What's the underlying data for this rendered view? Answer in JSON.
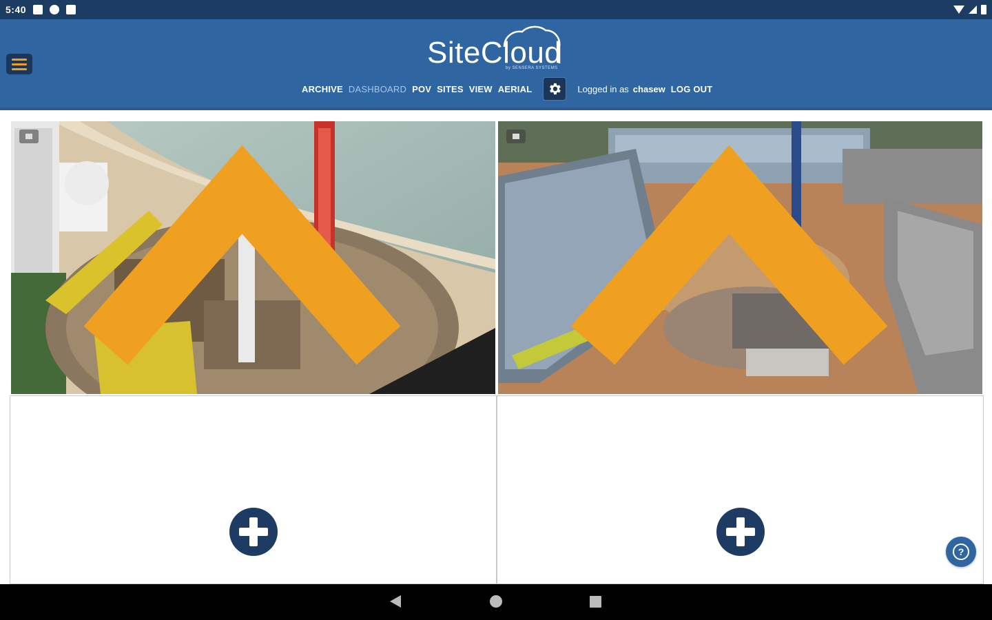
{
  "status_bar": {
    "time": "5:40",
    "icons": [
      "notification-icon",
      "app-icon",
      "sd-card-icon"
    ],
    "right_icons": [
      "wifi-icon",
      "signal-icon",
      "battery-icon"
    ]
  },
  "header": {
    "logo_text": "SiteCloud",
    "logo_sub": "by SENSERA SYSTEMS",
    "nav_links": [
      "ARCHIVE",
      "DASHBOARD",
      "POV",
      "SITES",
      "VIEW",
      "AERIAL"
    ],
    "active_link": "DASHBOARD",
    "logged_in_prefix": "Logged in as",
    "username": "chasew",
    "logout_label": "LOG OUT"
  },
  "colors": {
    "header_bg": "#2f65a0",
    "status_bg": "#1d3c63",
    "button_dark": "#1b3658",
    "menu_accent": "#f0a021",
    "active_link": "#a7c7ef",
    "add_button": "#1d3b63"
  },
  "camera_tiles": [
    {
      "scene": "beachfront-tower-construction",
      "expand_icon": "chevron-up-icon"
    },
    {
      "scene": "building-site-aerial",
      "expand_icon": "chevron-up-icon"
    }
  ],
  "empty_tiles": [
    {
      "icon": "plus-icon"
    },
    {
      "icon": "plus-icon"
    }
  ],
  "help_icon": "help-icon",
  "help_glyph": "?",
  "nav_bar": [
    "back-icon",
    "home-icon",
    "recents-icon"
  ]
}
